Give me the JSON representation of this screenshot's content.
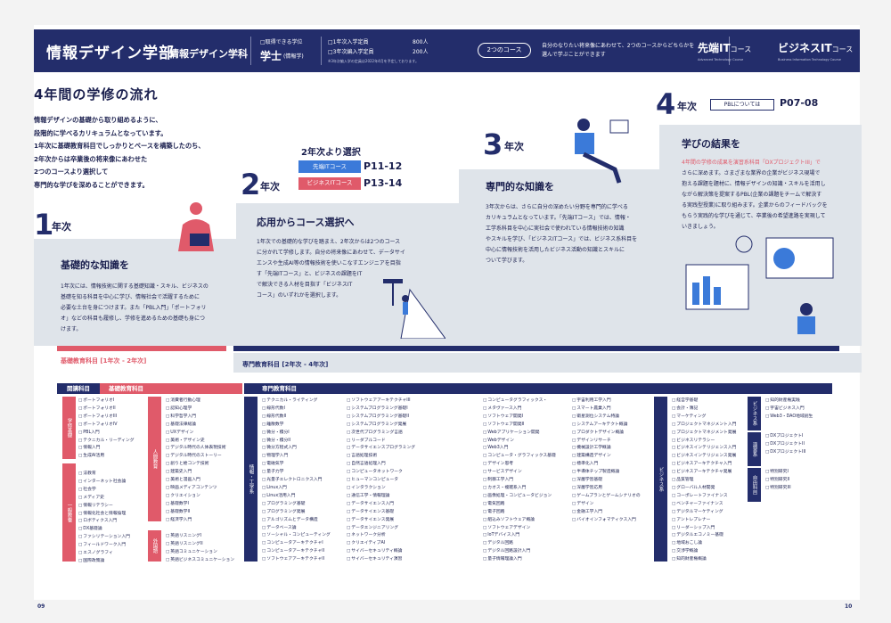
{
  "header": {
    "title": "情報デザイン学部",
    "dept": "情報デザイン学科",
    "degree_label": "□取得できる学位",
    "degree": "学士",
    "degree_sub": "(情報学)",
    "cap1_label": "□1年次入学定員",
    "cap1": "800人",
    "cap2_label": "□3年次編入学定員",
    "cap2": "200人",
    "cap_note": "※3年次編入学の定員は2022年4月を予定しております。",
    "courses_pill": "2つのコース",
    "desc": "自分のなりたい将来像にあわせて、2つのコースからどちらかを選んで学ぶことができます",
    "course1": "先端IT",
    "course1_small": "コース",
    "course1_sub": "Advanced Technology Course",
    "course2": "ビジネスIT",
    "course2_small": "コース",
    "course2_sub": "Business Information Technology Course"
  },
  "heading": "4年間の学修の流れ",
  "intro": [
    "情報デザインの基礎から取り組めるように、",
    "段階的に学べるカリキュラムとなっています。",
    "1年次に基礎教育科目でしっかりとベースを構築したのち、",
    "2年次からは卒業後の将来像にあわせた",
    "2つのコースより選択して",
    "専門的な学びを深めることができます。"
  ],
  "years": {
    "y1": "1",
    "y2": "2",
    "y3": "3",
    "y4": "4",
    "suffix": "年次"
  },
  "step1": {
    "title": "基礎的な知識を",
    "body": [
      "1年次には、情報技術に関する基礎知識・スキル、ビジネスの",
      "基礎を知る科目を中心に学び、情報社会で活躍するために",
      "必要な土台を身につけます。また「PBL入門」「ポートフォリ",
      "オ」などの科目も履修し、学修を進めるための基礎も身につ",
      "けます。"
    ]
  },
  "step2": {
    "title": "応用からコース選択へ",
    "select": "2年次より選択",
    "c1": "先端ITコース",
    "c1p": "P11-12",
    "c2": "ビジネスITコース",
    "c2p": "P13-14",
    "body": [
      "1年次での基礎的な学びを踏まえ、2年次からは2つのコース",
      "に分かれて学修します。自分の将来像にあわせて、データサイ",
      "エンスや生成AI等の情報技術を使いこなすエンジニアを目指",
      "す「先端ITコース」と、ビジネスの課題をIT",
      "で解決できる人材を目指す「ビジネスIT",
      "コース」のいずれかを選択します。"
    ]
  },
  "step3": {
    "title": "専門的な知識を",
    "body": [
      "3年次からは、さらに自分の深めたい分野を専門的に学べる",
      "カリキュラムとなっています。「先端ITコース」では、情報・",
      "工学系科目を中心に実社会で使われている情報技術の知識",
      "やスキルを学び、「ビジネスITコース」では、ビジネス系科目を",
      "中心に情報技術を活用したビジネス活動の知識とスキルに",
      "ついて学びます。"
    ]
  },
  "step4": {
    "title": "学びの結果を",
    "pbl": "PBLについては",
    "pbl_p": "P07-08",
    "body": [
      "4年間の学修の成果を演習系科目「DXプロジェクトIII」で",
      "さらに深めます。さまざまな業界の企業がビジネス現場で",
      "抱える課題を題材に、情報デザインの知識・スキルを活用し",
      "ながら解決策を提案するPBL(企業の課題をチームで解決す",
      "る実践型授業)に取り組みます。企業からのフィードバックを",
      "もらう実践的な学びを通じて、卒業後の希望進路を実現して",
      "いきましょう。"
    ]
  },
  "bands": {
    "b1": "基礎教育科目 [1年次 - 2年次]",
    "b2": "専門教育科目 [2年次 - 4年次]"
  },
  "table": {
    "h_area": "開講科目",
    "h_basic": "基礎教育科目",
    "h_spec": "専門教育科目",
    "side_gakusyu": "学修基礎",
    "side_ippan": "一般教養",
    "side_jinbun": "人間教育",
    "side_gaikoku": "外国語",
    "side_joho": "情報・工学系",
    "side_biz": "ビジネス系",
    "side_enshu": "ビジネス系",
    "side_pbl": "演習系",
    "side_jiyu": "自由科目",
    "c1a": [
      "ポートフォリオI",
      "ポートフォリオII",
      "ポートフォリオIII",
      "ポートフォリオIV",
      "PBL入門",
      "テクニカル・リーディング",
      "情報入門",
      "生成AI活用"
    ],
    "c1b": [
      "法教育",
      "インターネット社会論",
      "社会学",
      "メディア史",
      "情報リテラシー",
      "情報化社会と情報倫理",
      "ロボティクス入門",
      "DX基礎論",
      "ファシリテーション入門",
      "フィールドワーク入門",
      "エスノグラフィ",
      "国際政策論"
    ],
    "c2a": [
      "消費者行動心理",
      "認知心理学",
      "科学哲学入門",
      "基礎法律総論",
      "UXデザイン",
      "美術・デザイン史",
      "デジタル時代の人体表現技術",
      "デジタル時代のストーリー",
      "創りと絵コンテ技術",
      "建築史入門",
      "美術と漫画入門",
      "映画メディアコンテンツ",
      "クリエイション",
      "基礎数学I",
      "基礎数学II",
      "経済学入門"
    ],
    "c2b": [
      "英語リスニングI",
      "英語リスニングII",
      "英語コミュニケーション",
      "英語ビジネスコミュニケーション"
    ],
    "c3": [
      "テクニカル・ライティング",
      "線形代数I",
      "線形代数II",
      "離散数学",
      "微分・積分I",
      "微分・積分II",
      "微分方程式入門",
      "物理学入門",
      "電磁気学",
      "量子力学",
      "光量子エレクトロニクス入門",
      "Linux入門",
      "Linux活用入門",
      "プログラミング基礎",
      "プログラミング発展",
      "アルゴリズムとデータ構造",
      "データベース論",
      "ソーシャル・コンピューティング",
      "コンピュータアーキテクチャI",
      "コンピュータアーキテクチャII",
      "ソフトウェアアーキテクチャII"
    ],
    "c4": [
      "ソフトウェアアーキテクチャIII",
      "システムプログラミング基礎I",
      "システムプログラミング基礎II",
      "システムプログラミング発展",
      "次世代プログラミング言語",
      "リーダブルコード",
      "データサイエンスプログラミング",
      "言語処理技術",
      "自然言語処理入門",
      "コンピュータネットワーク",
      "ヒューマンコンピュータ",
      "インタラクション",
      "通信工学・情報理論",
      "データサイエンス入門",
      "データサイエンス基礎",
      "データサイエンス発展",
      "データエンジニアリング",
      "ネットワーク分析",
      "クリエイティブAI",
      "サイバーセキュリティ概論",
      "サイバーセキュリティ演習"
    ],
    "c5": [
      "コンピュータグラフィックス・",
      "メタヴァース入門",
      "ソフトウェア開発I",
      "ソフトウェア開発II",
      "Webアプリケーション開発",
      "Webデザイン",
      "Web3入門",
      "コンピュータ・グラフィックス基礎",
      "デザイン思考",
      "サービスデザイン",
      "制御工学入門",
      "カオス・複雑系入門",
      "画像処理・コンピュータビジョン",
      "電気回路",
      "電子回路",
      "組込みソフトウェア概論",
      "ソフトウェアデザイン",
      "IoTデバイス入門",
      "デジタル回路",
      "デジタル回路設計入門",
      "量子情報理論入門"
    ],
    "c6": [
      "宇宙利用工学入門",
      "スマート農業入門",
      "衛星測位システム特論",
      "システムアーキテクト概論",
      "プロダクトデザイン概論",
      "デザインリサーチ",
      "機械設計工学概論",
      "建築構造デザイン",
      "標準化入門",
      "半導体チップ製造概論",
      "深層学習基礎",
      "深層学習応用",
      "ゲームプランとゲームシナリオの",
      "デザイン",
      "金融工学入門",
      "バイオインフォマティクス入門"
    ],
    "c7": [
      "経営学基礎",
      "会計・簿記",
      "マーケティング",
      "プロジェクトマネジメント入門",
      "プロジェクトマネジメント発展",
      "ビジネスリテラシー",
      "ビジネスインテリジェンス入門",
      "ビジネスインテリジェンス発展",
      "ビジネスアーキテクチャ入門",
      "ビジネスアーキテクチャ発展",
      "品質管理",
      "グローバル人材開発",
      "コーポレートファイナンス",
      "ベンチャーファイナンス",
      "デジタルマーケティング",
      "アントレプレナー",
      "リーダーシップ入門",
      "デジタルエコノミー基礎",
      "地域おこし論",
      "交渉学概論",
      "知的財産権概論"
    ],
    "c8a": [
      "知的財産権実践",
      "宇宙ビジネス入門",
      "Web3・DAO地域創生"
    ],
    "c8b": [
      "DXプロジェクトI",
      "DXプロジェクトII",
      "DXプロジェクトIII"
    ],
    "c8c": [
      "特別研究I",
      "特別研究II",
      "特別研究III"
    ]
  },
  "footer": {
    "left": "09",
    "right": "10"
  },
  "colors": {
    "navy": "#232d6b",
    "red": "#e05a6a",
    "blue": "#3b7ad9",
    "stair": "#dfe4ea"
  }
}
